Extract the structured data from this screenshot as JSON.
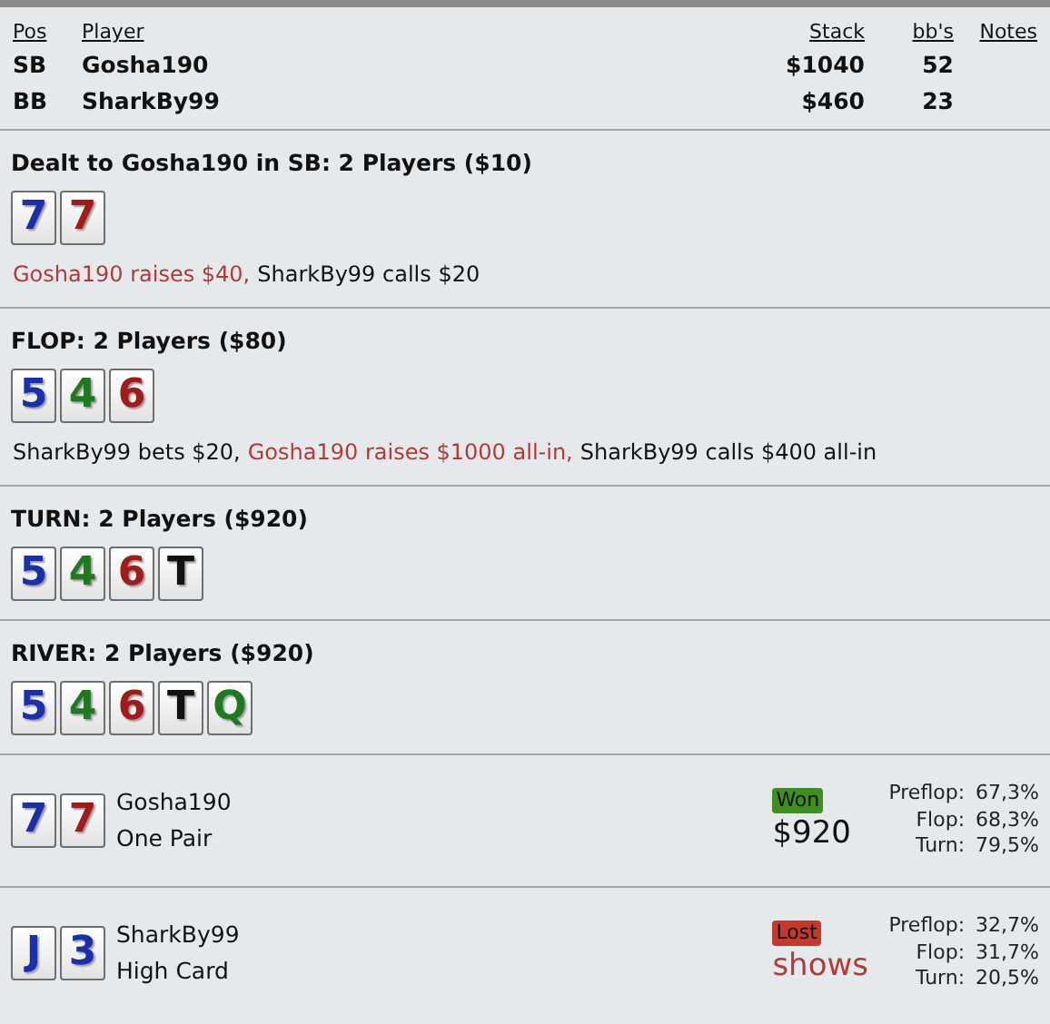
{
  "players_table": {
    "columns": [
      "Pos",
      "Player",
      "Stack",
      "bb's",
      "Notes"
    ],
    "rows": [
      {
        "pos": "SB",
        "player": "Gosha190",
        "stack": "$1040",
        "bbs": "52"
      },
      {
        "pos": "BB",
        "player": "SharkBy99",
        "stack": "$460",
        "bbs": "23"
      }
    ]
  },
  "streets": [
    {
      "title": "Dealt to Gosha190 in SB: 2 Players ($10)",
      "cards": [
        {
          "rank": "7",
          "color": "#1a2fa8"
        },
        {
          "rank": "7",
          "color": "#a01c1c"
        }
      ],
      "actions": [
        {
          "text": "Gosha190 raises $40,",
          "hero": true
        },
        {
          "text": "SharkBy99 calls $20",
          "hero": false
        }
      ]
    },
    {
      "title": "FLOP: 2 Players ($80)",
      "cards": [
        {
          "rank": "5",
          "color": "#1a2fa8"
        },
        {
          "rank": "4",
          "color": "#1f7a1f"
        },
        {
          "rank": "6",
          "color": "#a01c1c"
        }
      ],
      "actions": [
        {
          "text": "SharkBy99 bets $20,",
          "hero": false
        },
        {
          "text": "Gosha190 raises $1000 all-in,",
          "hero": true
        },
        {
          "text": "SharkBy99 calls $400 all-in",
          "hero": false
        }
      ]
    },
    {
      "title": "TURN: 2 Players ($920)",
      "cards": [
        {
          "rank": "5",
          "color": "#1a2fa8"
        },
        {
          "rank": "4",
          "color": "#1f7a1f"
        },
        {
          "rank": "6",
          "color": "#a01c1c"
        },
        {
          "rank": "T",
          "color": "#111111"
        }
      ]
    },
    {
      "title": "RIVER: 2 Players ($920)",
      "cards": [
        {
          "rank": "5",
          "color": "#1a2fa8"
        },
        {
          "rank": "4",
          "color": "#1f7a1f"
        },
        {
          "rank": "6",
          "color": "#a01c1c"
        },
        {
          "rank": "T",
          "color": "#111111"
        },
        {
          "rank": "Q",
          "color": "#1f7a1f"
        }
      ]
    }
  ],
  "results": [
    {
      "cards": [
        {
          "rank": "7",
          "color": "#1a2fa8"
        },
        {
          "rank": "7",
          "color": "#a01c1c"
        }
      ],
      "player": "Gosha190",
      "hand": "One Pair",
      "kind": "won",
      "badge": "Won",
      "amount": "$920",
      "equity": [
        {
          "label": "Preflop:",
          "value": "67,3%"
        },
        {
          "label": "Flop:",
          "value": "68,3%"
        },
        {
          "label": "Turn:",
          "value": "79,5%"
        }
      ]
    },
    {
      "cards": [
        {
          "rank": "J",
          "color": "#1a2fa8"
        },
        {
          "rank": "3",
          "color": "#1a2fa8"
        }
      ],
      "player": "SharkBy99",
      "hand": "High Card",
      "kind": "lost",
      "badge": "Lost",
      "amount": "shows",
      "equity": [
        {
          "label": "Preflop:",
          "value": "32,7%"
        },
        {
          "label": "Flop:",
          "value": "31,7%"
        },
        {
          "label": "Turn:",
          "value": "20,5%"
        }
      ]
    }
  ]
}
